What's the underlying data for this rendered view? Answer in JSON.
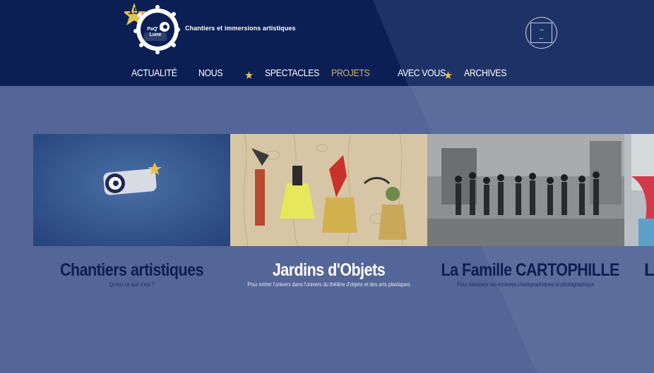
{
  "header": {
    "logo_badge": "15",
    "logo_text": "PaQ' la Lune",
    "tagline": "Chantiers et immersions artistiques",
    "lang_toggle": {
      "up_arrow": "→",
      "down_arrow": "←"
    }
  },
  "nav": {
    "items": [
      {
        "label": "ACTUALITÉ",
        "active": false
      },
      {
        "label": "NOUS",
        "active": false
      },
      {
        "label": "SPECTACLES",
        "active": false
      },
      {
        "label": "PROJETS",
        "active": true
      },
      {
        "label": "AVEC VOUS",
        "active": false
      },
      {
        "label": "ARCHIVES",
        "active": false
      }
    ],
    "star_icon": "star-icon"
  },
  "projects": [
    {
      "title": "Chantiers artistiques",
      "subtitle": "Qu'est ce que c'est ?",
      "highlight": false
    },
    {
      "title": "Jardins d'Objets",
      "subtitle": "Pour entrer l'univers dans l'univers du théâtre d'objets et des arts plastiques",
      "highlight": true
    },
    {
      "title": "La Famille CARTOPHILLE",
      "subtitle": "Pour découvrir les écritures chorégraphiques et photographique",
      "highlight": false
    },
    {
      "title": "Le",
      "subtitle": "",
      "highlight": false
    }
  ],
  "colors": {
    "header_bg": "#0b1f55",
    "page_bg": "#546597",
    "active_nav": "#c8b27a",
    "star": "#e2c24a",
    "title_dark": "#0d1f52"
  }
}
